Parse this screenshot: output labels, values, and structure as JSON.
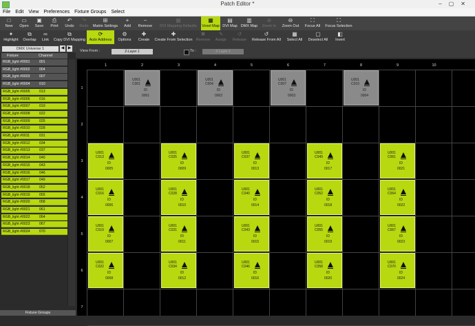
{
  "window": {
    "title": "Patch Editor *"
  },
  "menu": [
    "File",
    "Edit",
    "View",
    "Preferences",
    "Fixture Groups",
    "Select"
  ],
  "toolbar1": [
    {
      "label": "New",
      "icon": "□",
      "state": "normal"
    },
    {
      "label": "Open",
      "icon": "▭",
      "state": "normal"
    },
    {
      "label": "Save",
      "icon": "▣",
      "state": "normal"
    },
    {
      "label": "Print",
      "icon": "⎙",
      "state": "normal"
    },
    {
      "label": "Undo",
      "icon": "↶",
      "state": "normal"
    },
    {
      "label": "Redo",
      "icon": "↷",
      "state": "disabled"
    },
    {
      "label": "Matrix Settings",
      "icon": "⊞",
      "state": "normal"
    },
    {
      "label": "Add",
      "icon": "+",
      "state": "normal"
    },
    {
      "label": "Remove",
      "icon": "−",
      "state": "normal"
    },
    {
      "label": "DVI Mapping Defaults",
      "icon": "▦",
      "state": "disabled"
    },
    {
      "label": "Voxel Map",
      "icon": "▦",
      "state": "active"
    },
    {
      "label": "DVI Map",
      "icon": "▤",
      "state": "normal"
    },
    {
      "label": "DMX Map",
      "icon": "▥",
      "state": "normal"
    },
    {
      "label": "Zoom In",
      "icon": "⊕",
      "state": "disabled"
    },
    {
      "label": "Zoom Out",
      "icon": "⊖",
      "state": "normal"
    },
    {
      "label": "Focus All",
      "icon": "⛶",
      "state": "normal"
    },
    {
      "label": "Focus Selection",
      "icon": "⛶",
      "state": "normal"
    }
  ],
  "toolbar2": [
    {
      "label": "Highlight",
      "icon": "✦",
      "state": "normal"
    },
    {
      "label": "Overlap",
      "icon": "⧉",
      "state": "normal"
    },
    {
      "label": "Link",
      "icon": "∞",
      "state": "normal"
    },
    {
      "label": "Copy DVI Mapping",
      "icon": "⧉",
      "state": "normal"
    },
    {
      "label": "Auto Address",
      "icon": "⟳",
      "state": "active"
    },
    {
      "label": "Options",
      "icon": "⚙",
      "state": "normal"
    },
    {
      "label": "Create",
      "icon": "✚",
      "state": "normal"
    },
    {
      "label": "Create From Selection",
      "icon": "✚",
      "state": "normal"
    },
    {
      "label": "Remove",
      "icon": "✖",
      "state": "disabled"
    },
    {
      "label": "Assign",
      "icon": "✎",
      "state": "disabled"
    },
    {
      "label": "Release",
      "icon": "↺",
      "state": "disabled"
    },
    {
      "label": "Release From All",
      "icon": "↺",
      "state": "normal"
    },
    {
      "label": "Select All",
      "icon": "▦",
      "state": "normal"
    },
    {
      "label": "Deselect All",
      "icon": "▢",
      "state": "normal"
    },
    {
      "label": "Invert",
      "icon": "◧",
      "state": "normal"
    }
  ],
  "left": {
    "universe": "DMX Universe 1",
    "col_fixture": "Fixture",
    "col_channel": "Channel",
    "rows": [
      {
        "name": "RGB_light #0001",
        "ch": "001",
        "style": "dark"
      },
      {
        "name": "RGB_light #0002",
        "ch": "004",
        "style": "dark"
      },
      {
        "name": "RGB_light #0003",
        "ch": "007",
        "style": "dark"
      },
      {
        "name": "RGB_light #0004",
        "ch": "010",
        "style": "dark"
      },
      {
        "name": "RGB_light #0005",
        "ch": "013",
        "style": "green"
      },
      {
        "name": "RGB_light #0006",
        "ch": "016",
        "style": "green"
      },
      {
        "name": "RGB_light #0007",
        "ch": "019",
        "style": "green"
      },
      {
        "name": "RGB_light #0008",
        "ch": "022",
        "style": "green"
      },
      {
        "name": "RGB_light #0009",
        "ch": "025",
        "style": "green"
      },
      {
        "name": "RGB_light #0010",
        "ch": "028",
        "style": "green"
      },
      {
        "name": "RGB_light #0011",
        "ch": "031",
        "style": "green"
      },
      {
        "name": "RGB_light #0012",
        "ch": "034",
        "style": "green"
      },
      {
        "name": "RGB_light #0013",
        "ch": "037",
        "style": "green"
      },
      {
        "name": "RGB_light #0014",
        "ch": "040",
        "style": "green"
      },
      {
        "name": "RGB_light #0015",
        "ch": "043",
        "style": "green"
      },
      {
        "name": "RGB_light #0016",
        "ch": "046",
        "style": "green"
      },
      {
        "name": "RGB_light #0017",
        "ch": "049",
        "style": "green"
      },
      {
        "name": "RGB_light #0018",
        "ch": "052",
        "style": "green"
      },
      {
        "name": "RGB_light #0019",
        "ch": "055",
        "style": "green"
      },
      {
        "name": "RGB_light #0020",
        "ch": "058",
        "style": "green"
      },
      {
        "name": "RGB_light #0021",
        "ch": "061",
        "style": "green"
      },
      {
        "name": "RGB_light #0022",
        "ch": "064",
        "style": "green"
      },
      {
        "name": "RGB_light #0023",
        "ch": "067",
        "style": "green"
      },
      {
        "name": "RGB_light #0024",
        "ch": "070",
        "style": "green"
      }
    ],
    "fixture_groups": "Fixture Groups"
  },
  "view": {
    "view_from_label": "View From :",
    "view_from_value": "Z-Layer 1",
    "to_label": "To :",
    "to_value": "Z-Layer 1"
  },
  "grid": {
    "columns": [
      "1",
      "2",
      "3",
      "4",
      "5",
      "6",
      "7",
      "8",
      "9",
      "10"
    ],
    "rows": [
      "1",
      "2",
      "3",
      "4",
      "5",
      "6",
      "7"
    ],
    "id_label": "ID",
    "cells": [
      {
        "col": 2,
        "row": 1,
        "u": "U001",
        "c": "C001",
        "id": "0001",
        "color": "grey"
      },
      {
        "col": 4,
        "row": 1,
        "u": "U001",
        "c": "C004",
        "id": "0002",
        "color": "grey"
      },
      {
        "col": 6,
        "row": 1,
        "u": "U001",
        "c": "C007",
        "id": "0003",
        "color": "grey"
      },
      {
        "col": 8,
        "row": 1,
        "u": "U001",
        "c": "C010",
        "id": "0004",
        "color": "grey"
      },
      {
        "col": 1,
        "row": 3,
        "u": "U001",
        "c": "C013",
        "id": "0005",
        "color": "green"
      },
      {
        "col": 3,
        "row": 3,
        "u": "U001",
        "c": "C025",
        "id": "0009",
        "color": "green"
      },
      {
        "col": 5,
        "row": 3,
        "u": "U001",
        "c": "C037",
        "id": "0013",
        "color": "green"
      },
      {
        "col": 7,
        "row": 3,
        "u": "U001",
        "c": "C049",
        "id": "0017",
        "color": "green"
      },
      {
        "col": 9,
        "row": 3,
        "u": "U001",
        "c": "C061",
        "id": "0021",
        "color": "green"
      },
      {
        "col": 1,
        "row": 4,
        "u": "U001",
        "c": "C016",
        "id": "0006",
        "color": "green"
      },
      {
        "col": 3,
        "row": 4,
        "u": "U001",
        "c": "C028",
        "id": "0010",
        "color": "green"
      },
      {
        "col": 5,
        "row": 4,
        "u": "U001",
        "c": "C040",
        "id": "0014",
        "color": "green"
      },
      {
        "col": 7,
        "row": 4,
        "u": "U001",
        "c": "C052",
        "id": "0018",
        "color": "green"
      },
      {
        "col": 9,
        "row": 4,
        "u": "U001",
        "c": "C064",
        "id": "0022",
        "color": "green"
      },
      {
        "col": 1,
        "row": 5,
        "u": "U001",
        "c": "C019",
        "id": "0007",
        "color": "green"
      },
      {
        "col": 3,
        "row": 5,
        "u": "U001",
        "c": "C031",
        "id": "0011",
        "color": "green"
      },
      {
        "col": 5,
        "row": 5,
        "u": "U001",
        "c": "C043",
        "id": "0015",
        "color": "green"
      },
      {
        "col": 7,
        "row": 5,
        "u": "U001",
        "c": "C055",
        "id": "0019",
        "color": "green"
      },
      {
        "col": 9,
        "row": 5,
        "u": "U001",
        "c": "C067",
        "id": "0023",
        "color": "green"
      },
      {
        "col": 1,
        "row": 6,
        "u": "U001",
        "c": "C022",
        "id": "0008",
        "color": "green"
      },
      {
        "col": 3,
        "row": 6,
        "u": "U001",
        "c": "C034",
        "id": "0012",
        "color": "green"
      },
      {
        "col": 5,
        "row": 6,
        "u": "U001",
        "c": "C046",
        "id": "0016",
        "color": "green"
      },
      {
        "col": 7,
        "row": 6,
        "u": "U001",
        "c": "C058",
        "id": "0020",
        "color": "green"
      },
      {
        "col": 9,
        "row": 6,
        "u": "U001",
        "c": "C070",
        "id": "0024",
        "color": "green"
      }
    ]
  },
  "colors": {
    "accent": "#b8d80f",
    "fixture_grey": "#8a8a8a",
    "background": "#000000"
  }
}
